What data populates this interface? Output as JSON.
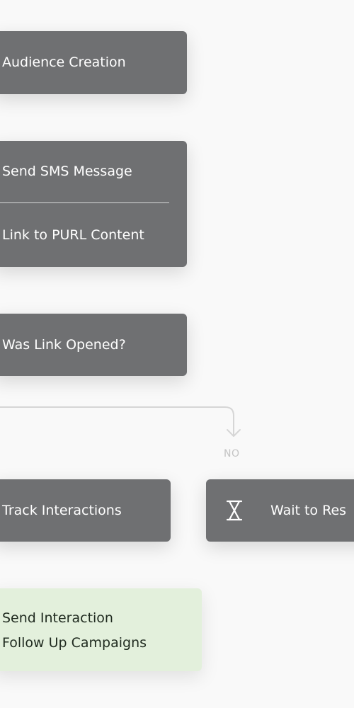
{
  "diagram": {
    "nodes": {
      "audience_creation": "Audience Creation",
      "send_sms": "Send SMS Message",
      "link_purl": "Link to PURL Content",
      "was_link_opened": "Was Link Opened?",
      "track_interactions": "Track Interactions",
      "wait_to_respond": "Wait to Res",
      "follow_up_line1": "Send Interaction",
      "follow_up_line2": "Follow Up Campaigns"
    },
    "branch_label_no": "NO",
    "icons": {
      "wait": "hourglass-icon",
      "connector": "arrow-down-icon"
    },
    "colors": {
      "background": "#f9f9f9",
      "node_gray": "#6f7072",
      "node_green": "#e3f0dc",
      "connector": "#d6d6d6",
      "branch_label": "#c4c4c4"
    }
  }
}
